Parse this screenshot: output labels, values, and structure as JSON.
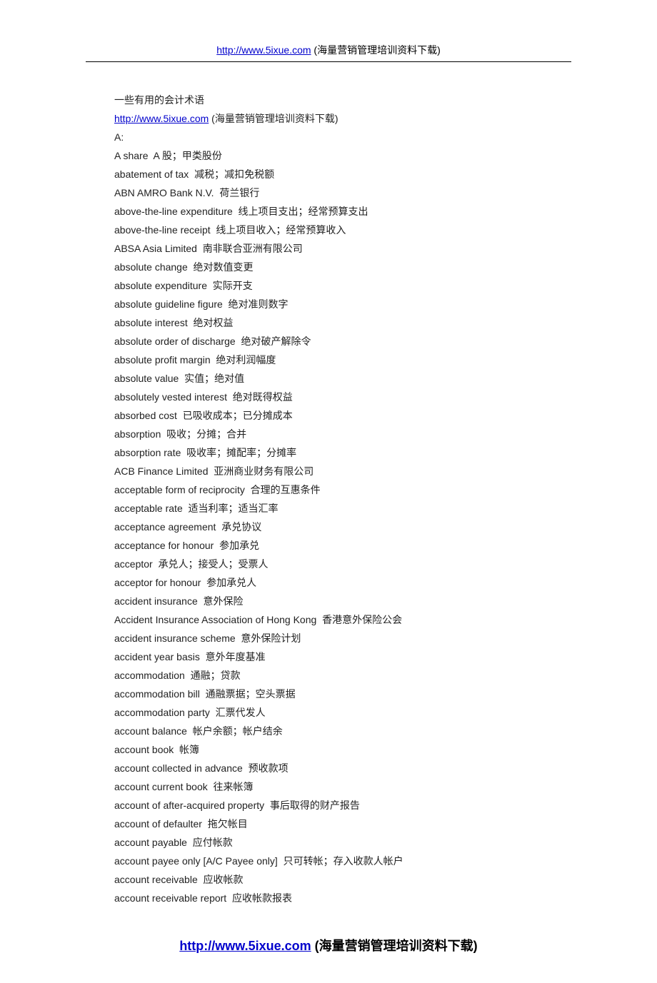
{
  "header": {
    "link_text": "http://www.5ixue.com",
    "link_suffix": " (海量营销管理培训资料下载)"
  },
  "content": {
    "title": "一些有用的会计术语",
    "source_link": "http://www.5ixue.com",
    "source_suffix": " (海量营销管理培训资料下载)",
    "section_heading": "A:",
    "entries": [
      "A share  A 股；甲类股份",
      "abatement of tax  减税；减扣免税额",
      "ABN AMRO Bank N.V.  荷兰银行",
      "above-the-line expenditure  线上项目支出；经常预算支出",
      "above-the-line receipt  线上项目收入；经常预算收入",
      "ABSA Asia Limited  南非联合亚洲有限公司",
      "absolute change  绝对数值变更",
      "absolute expenditure  实际开支",
      "absolute guideline figure  绝对准则数字",
      "absolute interest  绝对权益",
      "absolute order of discharge  绝对破产解除令",
      "absolute profit margin  绝对利润幅度",
      "absolute value  实值；绝对值",
      "absolutely vested interest  绝对既得权益",
      "absorbed cost  已吸收成本；已分摊成本",
      "absorption  吸收；分摊；合并",
      "absorption rate  吸收率；摊配率；分摊率",
      "ACB Finance Limited  亚洲商业财务有限公司",
      "acceptable form of reciprocity  合理的互惠条件",
      "acceptable rate  适当利率；适当汇率",
      "acceptance agreement  承兑协议",
      "acceptance for honour  参加承兑",
      "acceptor  承兑人；接受人；受票人",
      "acceptor for honour  参加承兑人",
      "accident insurance  意外保险",
      "Accident Insurance Association of Hong Kong  香港意外保险公会",
      "accident insurance scheme  意外保险计划",
      "accident year basis  意外年度基准",
      "accommodation  通融；贷款",
      "accommodation bill  通融票据；空头票据",
      "accommodation party  汇票代发人",
      "account balance  帐户余额；帐户结余",
      "account book  帐簿",
      "account collected in advance  预收款项",
      "account current book  往来帐簿",
      "account of after-acquired property  事后取得的财产报告",
      "account of defaulter  拖欠帐目",
      "account payable  应付帐款",
      "account payee only [A/C Payee only]  只可转帐；存入收款人帐户",
      "account receivable  应收帐款",
      "account receivable report  应收帐款报表"
    ]
  },
  "footer": {
    "link_text": "http://www.5ixue.com",
    "link_suffix": " (海量营销管理培训资料下载)"
  }
}
